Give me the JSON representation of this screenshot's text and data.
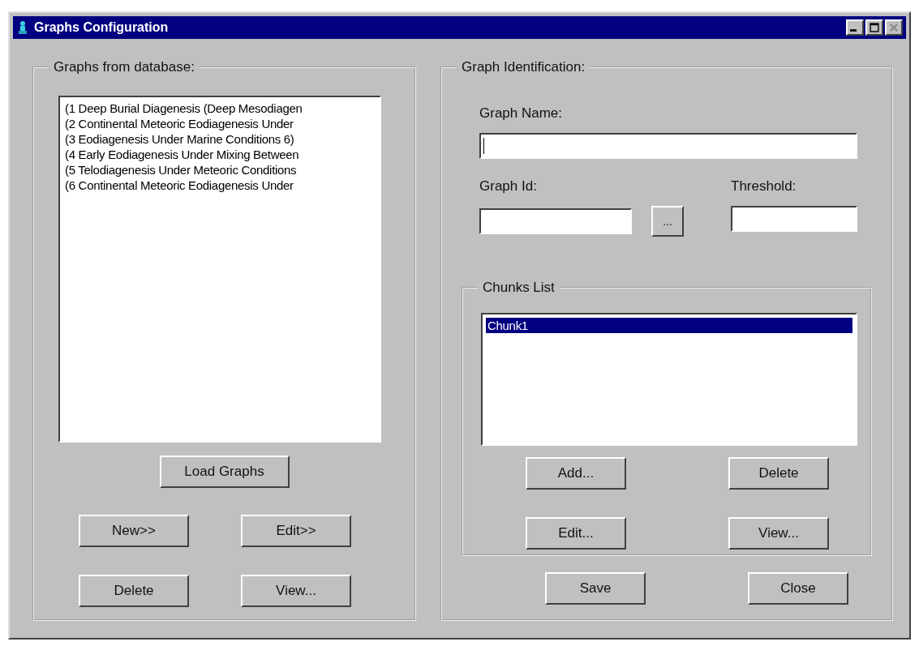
{
  "window": {
    "title": "Graphs Configuration"
  },
  "graphs_group": {
    "title": "Graphs from database:",
    "items": [
      {
        "label": "(1 Deep Burial Diagenesis (Deep Mesodiagen",
        "selected": false
      },
      {
        "label": "(2 Continental Meteoric Eodiagenesis Under",
        "selected": false
      },
      {
        "label": "(3 Eodiagenesis Under Marine Conditions 6)",
        "selected": false
      },
      {
        "label": "(4 Early Eodiagenesis Under Mixing Between",
        "selected": false
      },
      {
        "label": "(5 Telodiagenesis Under Meteoric Conditions",
        "selected": false
      },
      {
        "label": "(6 Continental Meteoric Eodiagenesis Under",
        "selected": false
      }
    ],
    "load_button": "Load Graphs",
    "buttons": [
      "New>>",
      "Edit>>",
      "Delete",
      "View..."
    ]
  },
  "identification_group": {
    "title": "Graph Identification:",
    "graph_name": {
      "label": "Graph Name:",
      "focused": true
    },
    "graph_id": {
      "label": "Graph Id:",
      "focused": false
    },
    "browse_button": "...",
    "threshold": {
      "label": "Threshold:",
      "focused": false
    },
    "chunks_group": {
      "title": "Chunks List",
      "items": [
        {
          "label": "Chunk1",
          "selected": true
        }
      ],
      "buttons": [
        "Add...",
        "Delete",
        "Edit...",
        "View..."
      ]
    },
    "buttons": [
      "Save",
      "Close"
    ]
  }
}
